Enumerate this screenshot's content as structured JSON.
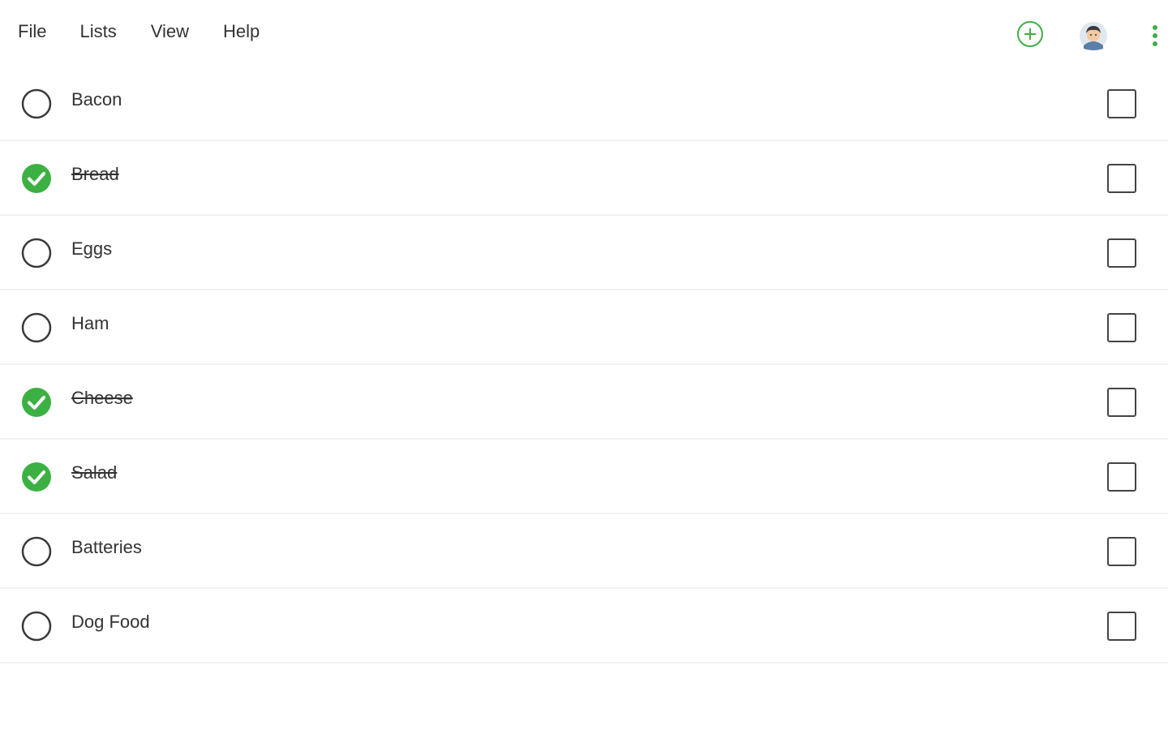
{
  "menu": {
    "file": "File",
    "lists": "Lists",
    "view": "View",
    "help": "Help"
  },
  "toolbar": {
    "add_icon": "add-circle-icon",
    "avatar_icon": "user-avatar-icon",
    "more_icon": "more-vertical-icon"
  },
  "colors": {
    "accent": "#3cb043",
    "text": "#333333",
    "divider": "#f1f1f1"
  },
  "items": [
    {
      "label": "Bacon",
      "completed": false,
      "selected": false
    },
    {
      "label": "Bread",
      "completed": true,
      "selected": false
    },
    {
      "label": "Eggs",
      "completed": false,
      "selected": false
    },
    {
      "label": "Ham",
      "completed": false,
      "selected": false
    },
    {
      "label": "Cheese",
      "completed": true,
      "selected": false
    },
    {
      "label": "Salad",
      "completed": true,
      "selected": false
    },
    {
      "label": "Batteries",
      "completed": false,
      "selected": false
    },
    {
      "label": "Dog Food",
      "completed": false,
      "selected": false
    }
  ]
}
